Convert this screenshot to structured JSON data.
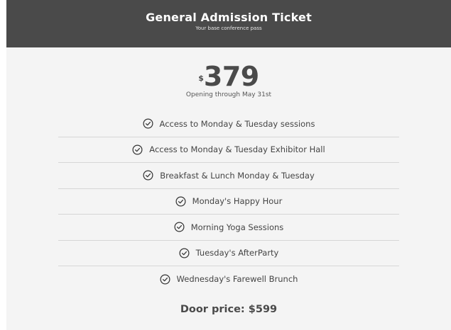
{
  "header": {
    "title": "General Admission Ticket",
    "subtitle": "Your base conference pass"
  },
  "price": {
    "currency": "$",
    "amount": "379",
    "note": "Opening through May 31st"
  },
  "features": [
    {
      "label": "Access to Monday & Tuesday sessions",
      "icon": "check-circle-icon"
    },
    {
      "label": "Access to Monday & Tuesday Exhibitor Hall",
      "icon": "check-circle-icon"
    },
    {
      "label": "Breakfast & Lunch Monday & Tuesday",
      "icon": "check-circle-icon"
    },
    {
      "label": "Monday's Happy Hour",
      "icon": "check-circle-icon"
    },
    {
      "label": "Morning Yoga Sessions",
      "icon": "check-circle-icon"
    },
    {
      "label": "Tuesday's AfterParty",
      "icon": "check-circle-icon"
    },
    {
      "label": "Wednesday's Farewell Brunch",
      "icon": "check-circle-icon"
    }
  ],
  "door_price": "Door price: $599",
  "colors": {
    "header_bg": "#4a4a4a",
    "card_bg": "#f4f4f4",
    "text": "#444444"
  }
}
